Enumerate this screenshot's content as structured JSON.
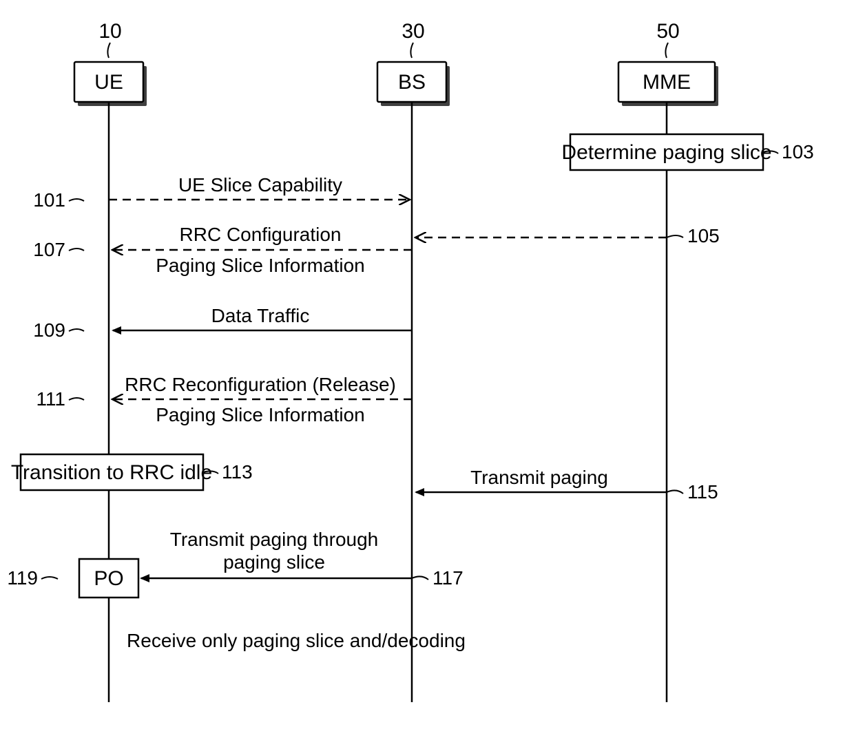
{
  "participants": {
    "ue": {
      "label": "UE",
      "ref": "10"
    },
    "bs": {
      "label": "BS",
      "ref": "30"
    },
    "mme": {
      "label": "MME",
      "ref": "50"
    }
  },
  "steps": {
    "s101": {
      "ref": "101",
      "text": "UE Slice Capability"
    },
    "s103": {
      "ref": "103",
      "text": "Determine paging slice"
    },
    "s105": {
      "ref": "105"
    },
    "s107": {
      "ref": "107",
      "line1": "RRC Configuration",
      "line2": "Paging Slice Information"
    },
    "s109": {
      "ref": "109",
      "text": "Data Traffic"
    },
    "s111": {
      "ref": "111",
      "line1": "RRC Reconfiguration (Release)",
      "line2": "Paging Slice Information"
    },
    "s113": {
      "ref": "113",
      "text": "Transition to RRC idle"
    },
    "s115": {
      "ref": "115",
      "text": "Transmit paging"
    },
    "s117": {
      "ref": "117",
      "line1": "Transmit paging through",
      "line2": "paging slice"
    },
    "s119": {
      "ref": "119",
      "text": "PO"
    },
    "footer": {
      "text": "Receive only paging slice and/decoding"
    }
  }
}
